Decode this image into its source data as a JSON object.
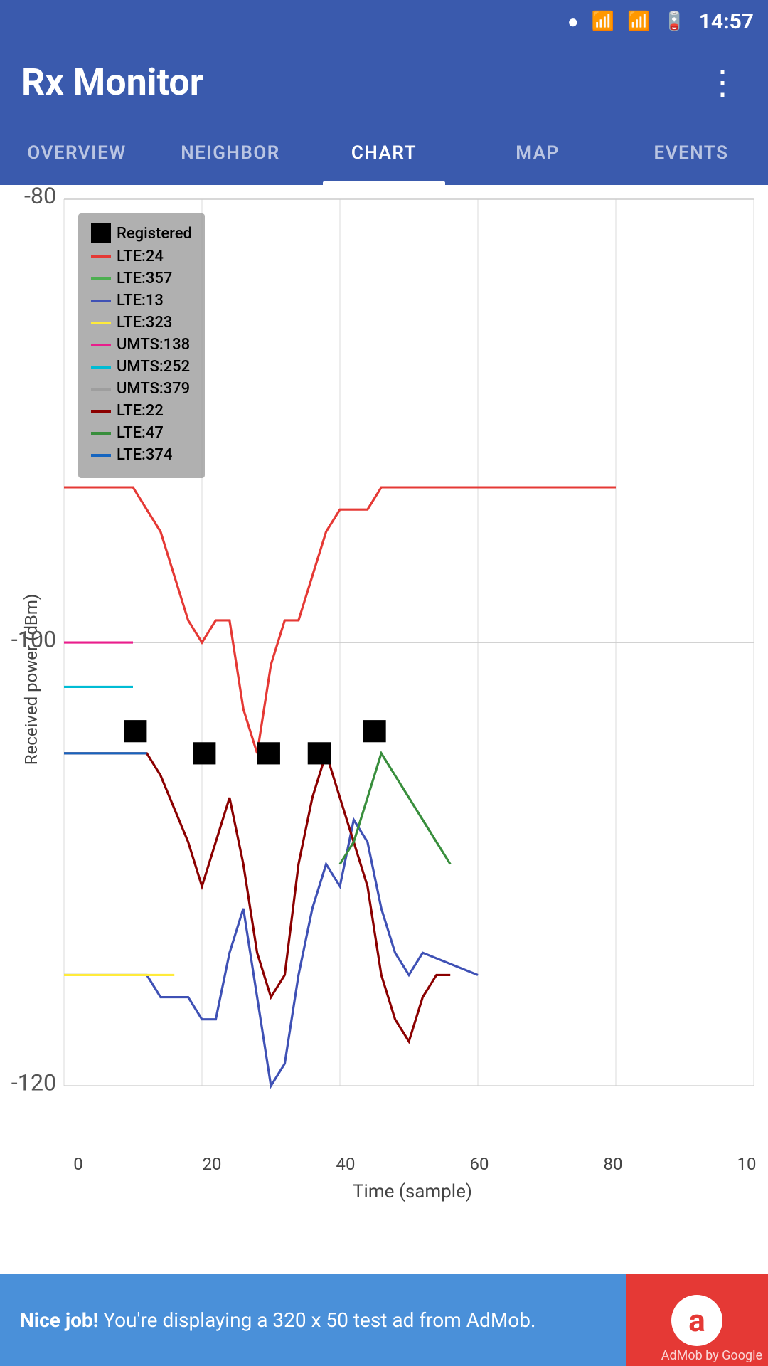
{
  "status_bar": {
    "time": "14:57"
  },
  "app_bar": {
    "title": "Rx Monitor",
    "overflow_menu_label": "⋮"
  },
  "tabs": [
    {
      "id": "overview",
      "label": "OVERVIEW",
      "active": false
    },
    {
      "id": "neighbor",
      "label": "NEIGHBOR",
      "active": false
    },
    {
      "id": "chart",
      "label": "CHART",
      "active": true
    },
    {
      "id": "map",
      "label": "MAP",
      "active": false
    },
    {
      "id": "events",
      "label": "EVENTS",
      "active": false
    }
  ],
  "chart": {
    "y_axis_label": "Received power (dBm)",
    "x_axis_label": "Time (sample)",
    "y_min": -120,
    "y_max": -80,
    "x_min": 0,
    "x_max": 100,
    "x_ticks": [
      "0",
      "20",
      "40",
      "60",
      "80",
      "10"
    ],
    "y_ticks": [
      "-80",
      "-100",
      "-120"
    ]
  },
  "legend": {
    "items": [
      {
        "label": "Registered",
        "color": "#000000",
        "type": "square"
      },
      {
        "label": "LTE:24",
        "color": "#e53935",
        "type": "line"
      },
      {
        "label": "LTE:357",
        "color": "#4caf50",
        "type": "line"
      },
      {
        "label": "LTE:13",
        "color": "#3f51b5",
        "type": "line"
      },
      {
        "label": "LTE:323",
        "color": "#ffeb3b",
        "type": "line"
      },
      {
        "label": "UMTS:138",
        "color": "#e91e8c",
        "type": "line"
      },
      {
        "label": "UMTS:252",
        "color": "#00bcd4",
        "type": "line"
      },
      {
        "label": "UMTS:379",
        "color": "#9e9e9e",
        "type": "line"
      },
      {
        "label": "LTE:22",
        "color": "#8b0000",
        "type": "line"
      },
      {
        "label": "LTE:47",
        "color": "#388e3c",
        "type": "line"
      },
      {
        "label": "LTE:374",
        "color": "#1565c0",
        "type": "line"
      }
    ]
  },
  "ad_banner": {
    "text_bold": "Nice job!",
    "text_normal": " You're displaying a 320 x 50 test ad from AdMob.",
    "admob_label": "AdMob by Google"
  }
}
